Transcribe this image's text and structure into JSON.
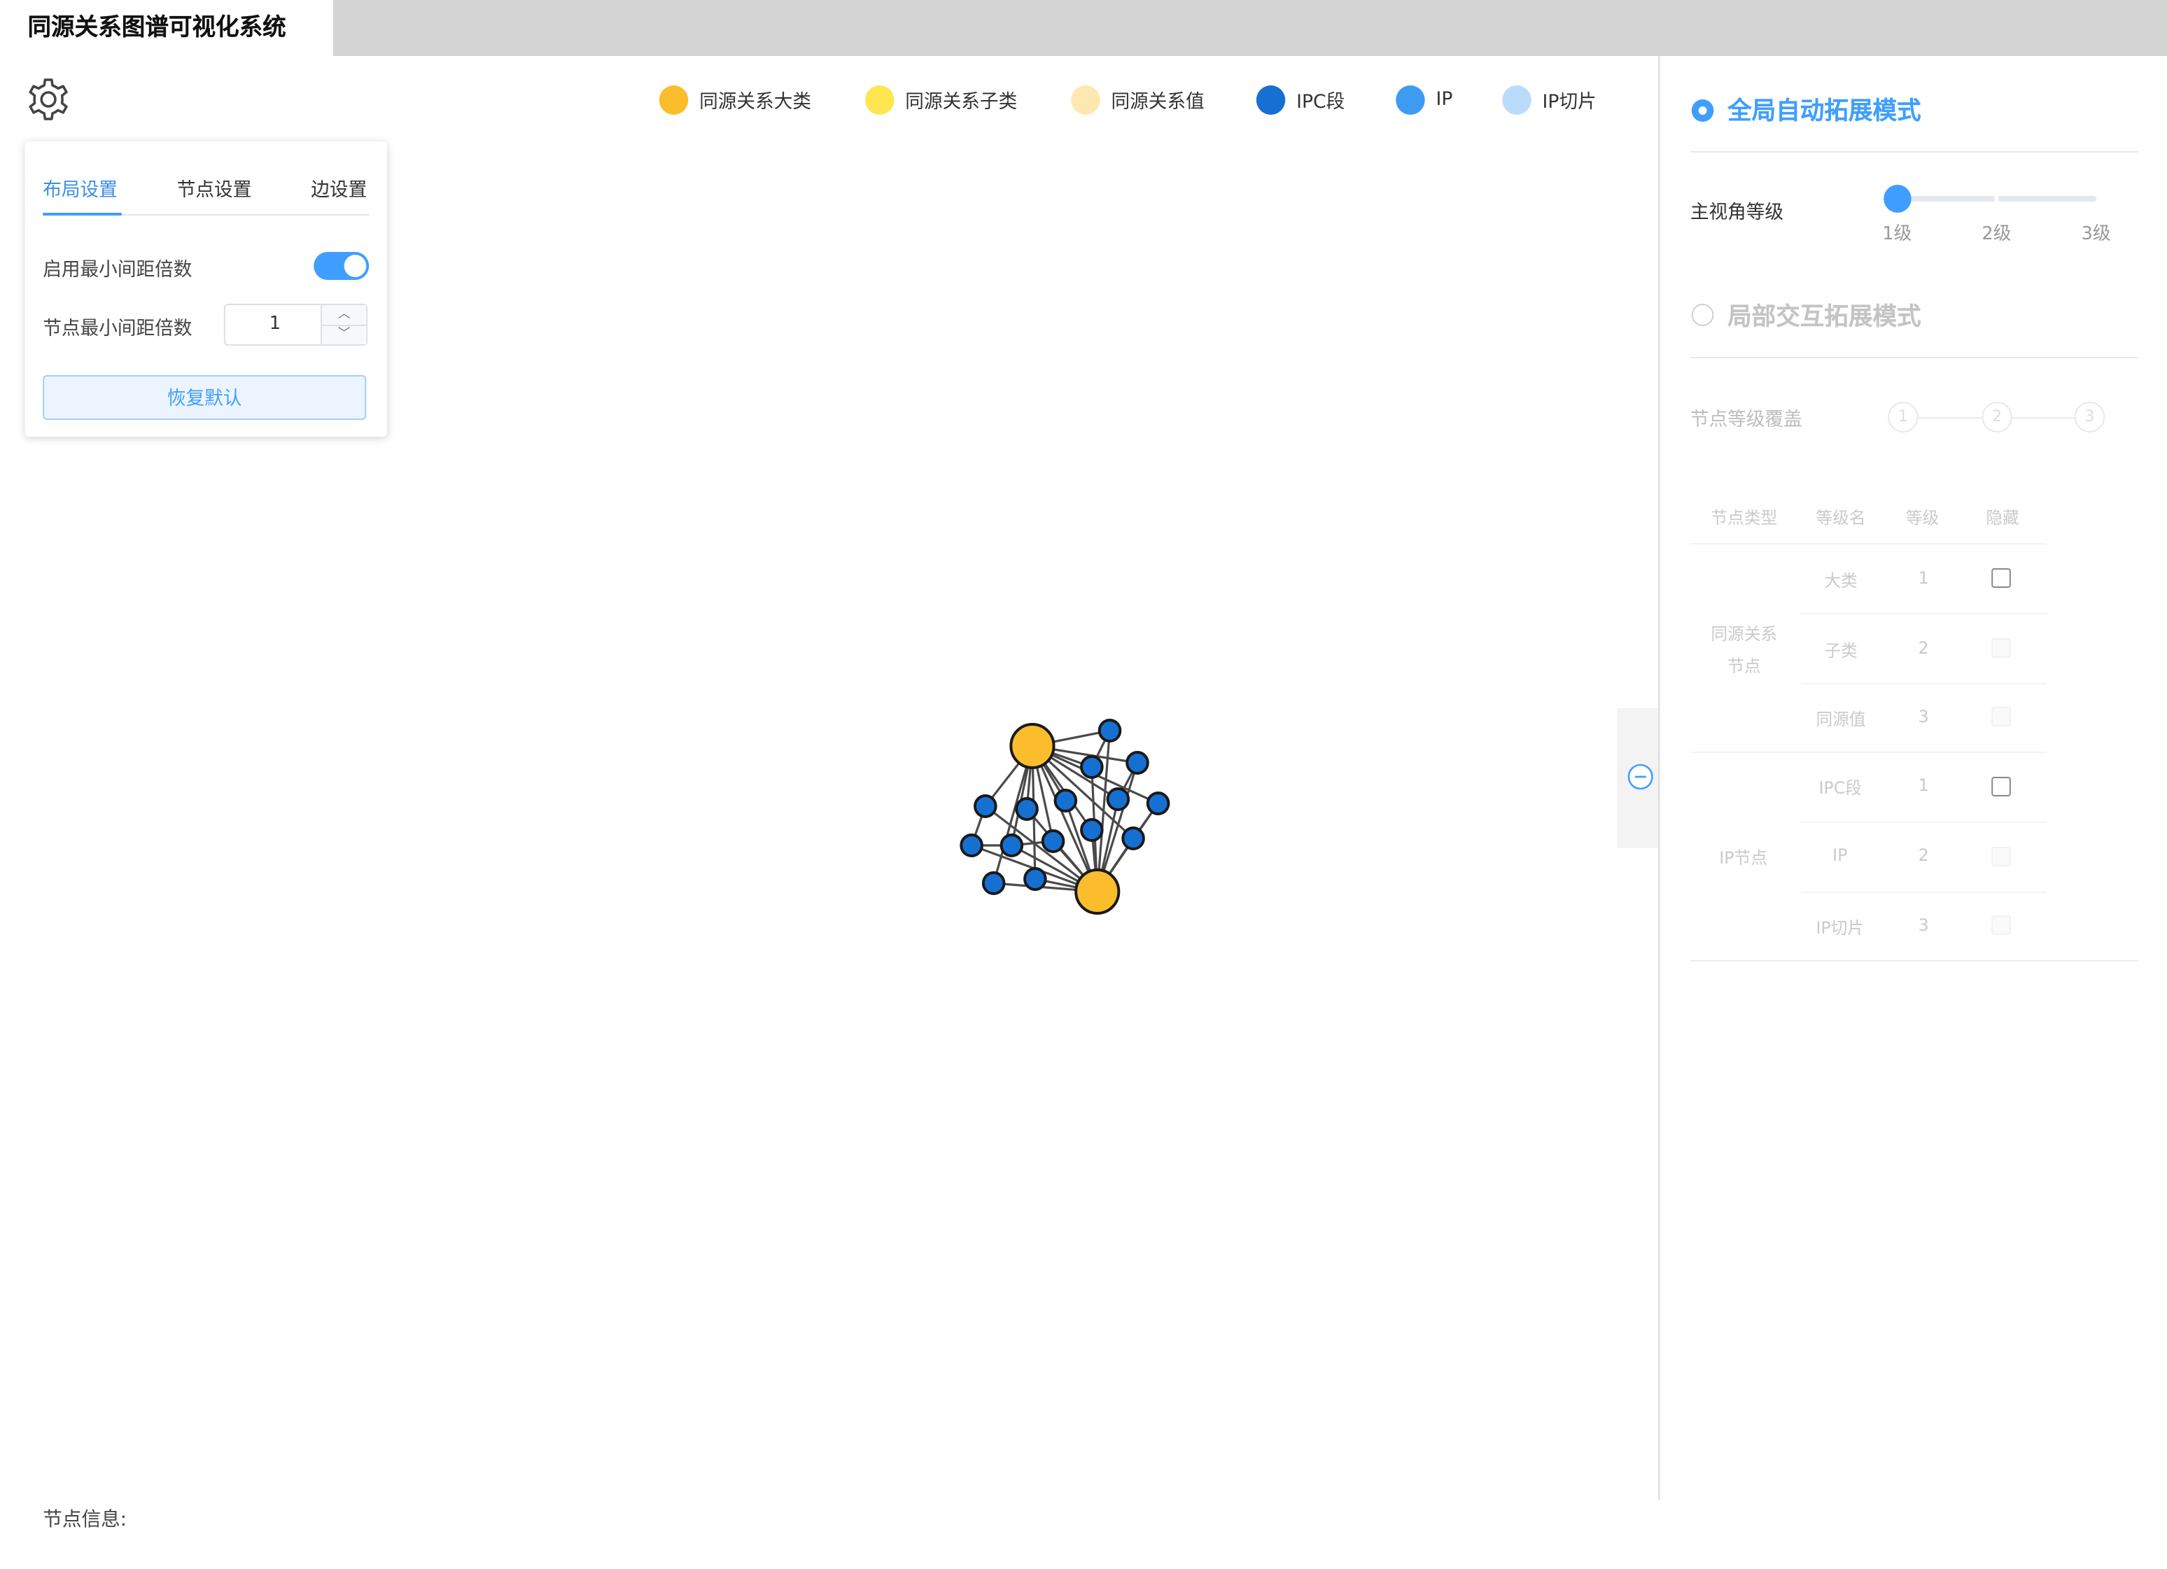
{
  "app": {
    "title": "同源关系图谱可视化系统"
  },
  "legend": [
    {
      "label": "同源关系大类",
      "color": "#fbbd2c"
    },
    {
      "label": "同源关系子类",
      "color": "#fde64f"
    },
    {
      "label": "同源关系值",
      "color": "#fde8b2"
    },
    {
      "label": "IPC段",
      "color": "#1670d2"
    },
    {
      "label": "IP",
      "color": "#3d9cf2"
    },
    {
      "label": "IP切片",
      "color": "#bbdbfb"
    }
  ],
  "settings": {
    "tabs": [
      "布局设置",
      "节点设置",
      "边设置"
    ],
    "active_tab": "布局设置",
    "min_spacing_toggle_label": "启用最小间距倍数",
    "min_spacing_toggle_on": true,
    "node_min_spacing_label": "节点最小间距倍数",
    "node_min_spacing_value": "1",
    "reset_label": "恢复默认"
  },
  "right_panel": {
    "global_mode_label": "全局自动拓展模式",
    "global_mode_selected": true,
    "view_level_label": "主视角等级",
    "view_level_marks": [
      "1级",
      "2级",
      "3级"
    ],
    "view_level_value": "1级",
    "local_mode_label": "局部交互拓展模式",
    "local_mode_selected": false,
    "node_level_cover_label": "节点等级覆盖",
    "steps": [
      "1",
      "2",
      "3"
    ],
    "table": {
      "headers": [
        "节点类型",
        "等级名",
        "等级",
        "隐藏"
      ],
      "groups": [
        {
          "type": "同源关系节点",
          "type_lines": [
            "同源关系",
            "节点"
          ],
          "rows": [
            {
              "name": "大类",
              "level": "1",
              "hidden_enabled": true
            },
            {
              "name": "子类",
              "level": "2",
              "hidden_enabled": false
            },
            {
              "name": "同源值",
              "level": "3",
              "hidden_enabled": false
            }
          ]
        },
        {
          "type": "IP节点",
          "type_lines": [
            "IP节点"
          ],
          "rows": [
            {
              "name": "IPC段",
              "level": "1",
              "hidden_enabled": true
            },
            {
              "name": "IP",
              "level": "2",
              "hidden_enabled": false
            },
            {
              "name": "IP切片",
              "level": "3",
              "hidden_enabled": false
            }
          ]
        }
      ]
    }
  },
  "footer": {
    "node_info_label": "节点信息:"
  }
}
